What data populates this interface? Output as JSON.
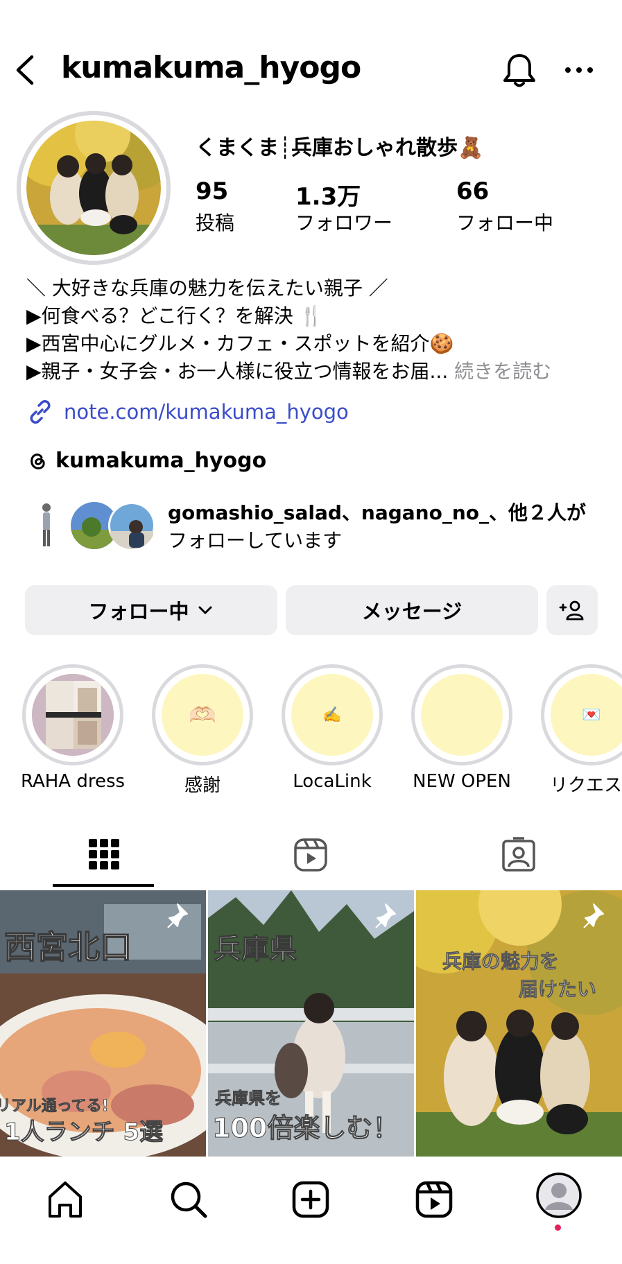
{
  "header": {
    "username": "kumakuma_hyogo"
  },
  "profile": {
    "display_name": "くまくま┊兵庫おしゃれ散歩🧸",
    "stats": [
      {
        "value": "95",
        "label": "投稿"
      },
      {
        "value": "1.3万",
        "label": "フォロワー"
      },
      {
        "value": "66",
        "label": "フォロー中"
      }
    ],
    "bio": [
      "＼ 大好きな兵庫の魅力を伝えたい親子 ／",
      "▶何食べる？どこ行く？を解決 🍴",
      "▶西宮中心にグルメ・カフェ・スポットを紹介🍪",
      "▶親子・女子会・お一人様に役立つ情報をお届..."
    ],
    "more_label": "続きを読む",
    "link": "note.com/kumakuma_hyogo",
    "threads_handle": "kumakuma_hyogo",
    "mutual_line1": "gomashio_salad、nagano_no_、他２人が",
    "mutual_line2": "フォローしています"
  },
  "actions": {
    "following_label": "フォロー中",
    "message_label": "メッセージ"
  },
  "highlights": [
    {
      "label": "RAHA dress",
      "emoji": ""
    },
    {
      "label": "感謝",
      "emoji": "🫶🏻"
    },
    {
      "label": "LocaLink",
      "emoji": "✍️"
    },
    {
      "label": "NEW OPEN",
      "emoji": ""
    },
    {
      "label": "リクエス",
      "emoji": "💌"
    }
  ],
  "posts": [
    {
      "title": "西宮北口",
      "sub1": "リアル通ってる!",
      "sub2": "1人ランチ 5選"
    },
    {
      "title": "兵庫県",
      "sub1": "兵庫県を",
      "sub2": "100倍楽しむ！"
    },
    {
      "title": "兵庫の魅力を",
      "sub1": "届けたい",
      "sub2": ""
    }
  ],
  "icons": {
    "header": [
      "back-icon",
      "bell-icon",
      "more-icon"
    ],
    "tabs": [
      "grid-icon",
      "reels-icon",
      "tagged-icon"
    ],
    "nav": [
      "home-icon",
      "search-icon",
      "create-icon",
      "reels-icon",
      "profile-icon"
    ]
  },
  "colors": {
    "link": "#3a4cc9",
    "button_bg": "#efeff2",
    "highlight_fill": "#fdf7bf",
    "notification_dot": "#e0245e"
  }
}
